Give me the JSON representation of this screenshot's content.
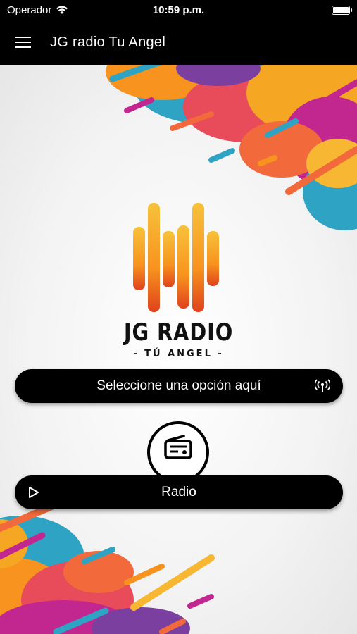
{
  "status_bar": {
    "carrier": "Operador",
    "time": "10:59 p.m.",
    "icons": [
      "wifi-icon",
      "battery-icon"
    ]
  },
  "app_bar": {
    "title": "JG radio Tu Angel",
    "menu_icon": "hamburger-menu-icon"
  },
  "logo": {
    "title": "JG RADIO",
    "subtitle": "- TÚ ANGEL -",
    "icon": "sound-bars-logo"
  },
  "select_button": {
    "label": "Seleccione una opción aquí",
    "icon": "broadcast-icon"
  },
  "radio_item": {
    "label": "Radio",
    "icon": "radio-icon",
    "play_icon": "play-icon"
  },
  "colors": {
    "bar_background": "#000000",
    "accent_orange": "#f7931e",
    "accent_magenta": "#c2268f",
    "accent_teal": "#2fa3c4",
    "accent_purple": "#7b3fa0"
  }
}
